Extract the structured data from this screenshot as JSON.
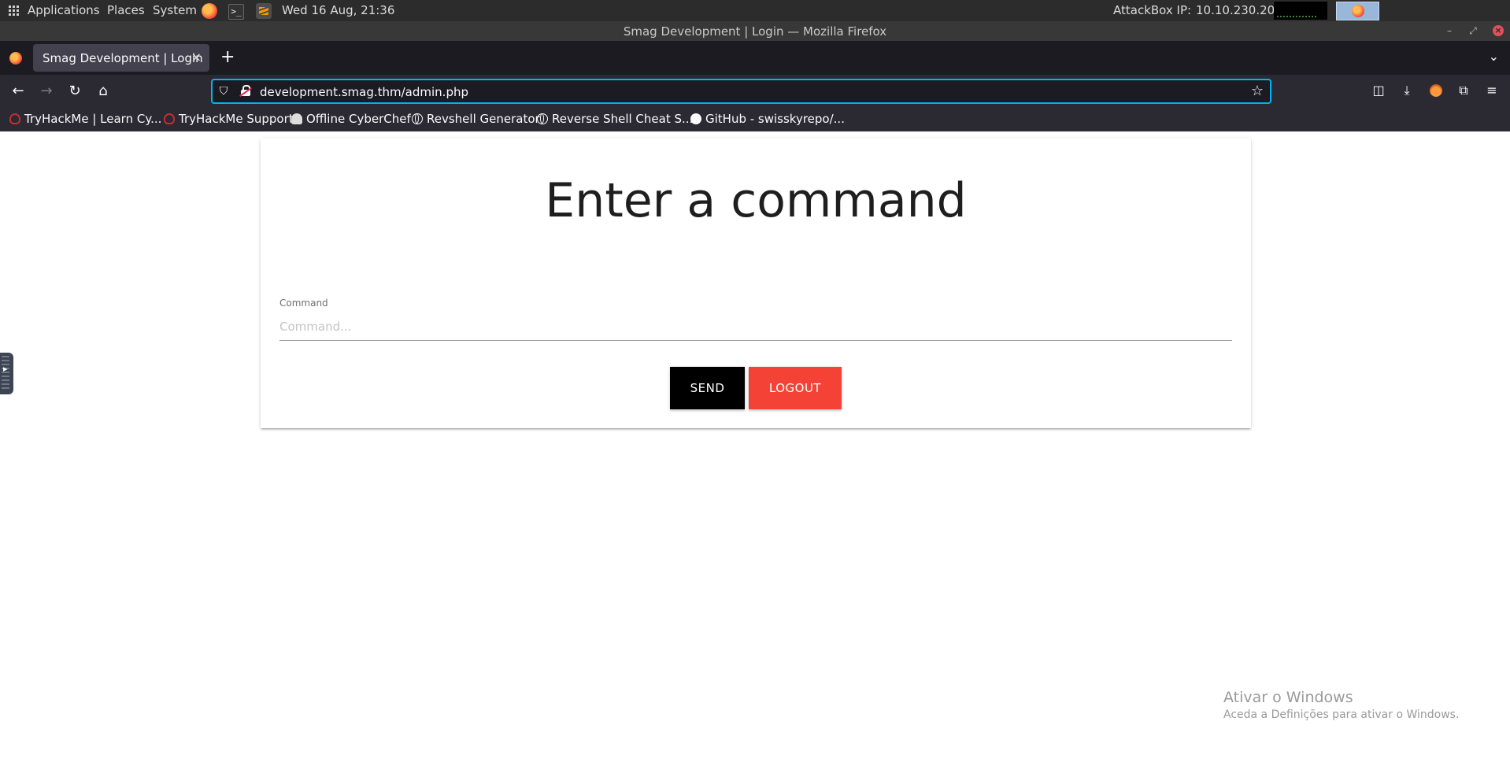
{
  "system_panel": {
    "applications_label": "Applications",
    "places_label": "Places",
    "system_label": "System",
    "datetime": "Wed 16 Aug, 21:36",
    "attackbox_label": "AttackBox IP:",
    "attackbox_ip": "10.10.230.202"
  },
  "window": {
    "title": "Smag Development | Login — Mozilla Firefox"
  },
  "browser": {
    "tabs": [
      {
        "label": "Smag Development | Login",
        "active": true
      }
    ],
    "new_tab_label": "+",
    "url": "development.smag.thm/admin.php",
    "bookmarks": [
      {
        "label": "TryHackMe | Learn Cy...",
        "icon": "tryhackme-icon"
      },
      {
        "label": "TryHackMe Support",
        "icon": "tryhackme-icon"
      },
      {
        "label": "Offline CyberChef",
        "icon": "chef-hat-icon"
      },
      {
        "label": "Revshell Generator",
        "icon": "globe-icon"
      },
      {
        "label": "Reverse Shell Cheat S...",
        "icon": "globe-icon"
      },
      {
        "label": "GitHub - swisskyrepo/...",
        "icon": "github-icon"
      }
    ]
  },
  "page": {
    "heading": "Enter a command",
    "command_field": {
      "label": "Command",
      "placeholder": "Command...",
      "value": ""
    },
    "send_button": "SEND",
    "logout_button": "LOGOUT"
  },
  "watermark": {
    "title": "Ativar o Windows",
    "subtitle": "Aceda a Definições para ativar o Windows."
  },
  "colors": {
    "url_focus_border": "#00b3f4",
    "send_button_bg": "#000000",
    "logout_button_bg": "#f44336",
    "tab_active_bg": "#42414d",
    "toolbar_bg": "#2b2a33"
  }
}
